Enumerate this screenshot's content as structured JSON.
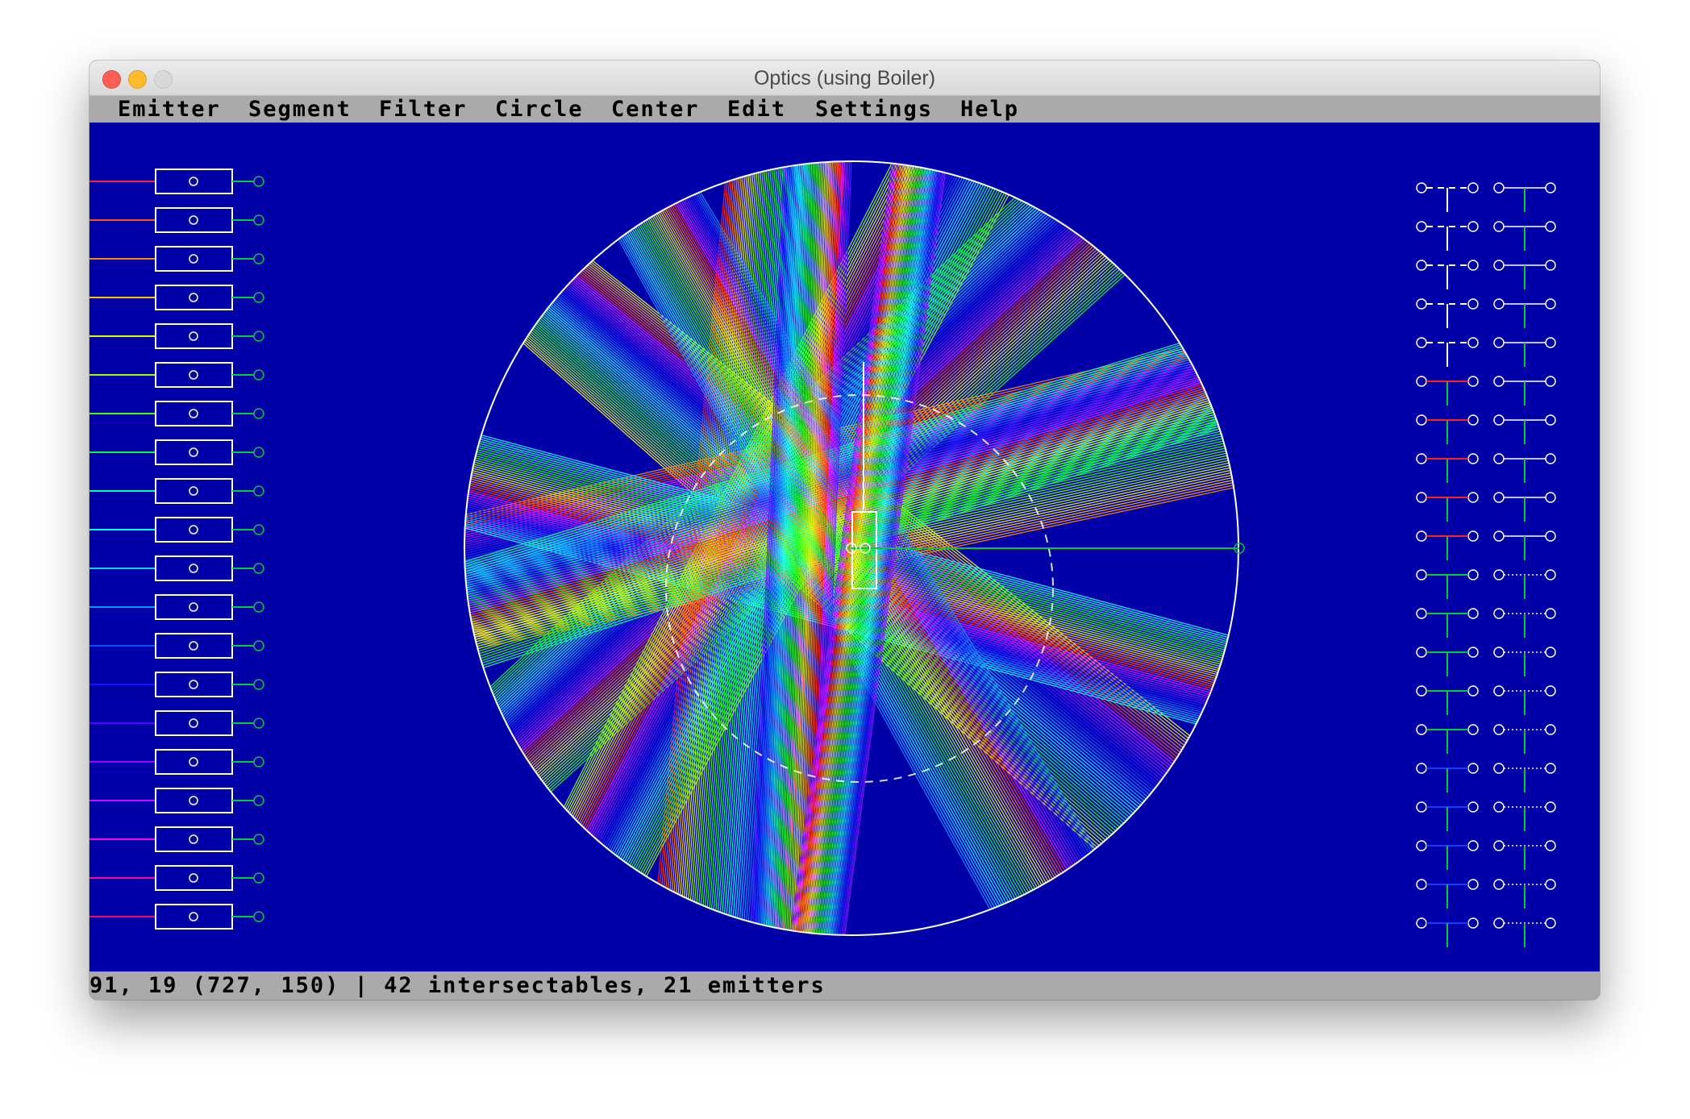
{
  "window": {
    "title": "Optics (using Boiler)"
  },
  "menu": [
    {
      "id": "emitter",
      "label": "Emitter"
    },
    {
      "id": "segment",
      "label": "Segment"
    },
    {
      "id": "filter",
      "label": "Filter"
    },
    {
      "id": "circle",
      "label": "Circle"
    },
    {
      "id": "center",
      "label": "Center"
    },
    {
      "id": "edit",
      "label": "Edit"
    },
    {
      "id": "settings",
      "label": "Settings"
    },
    {
      "id": "help",
      "label": "Help"
    }
  ],
  "status": {
    "text": "91, 19 (727, 150) | 42 intersectables, 21 emitters"
  },
  "scene": {
    "palette_count": 20,
    "emitter_colors": [
      "#ff1f3f",
      "#ff4d1a",
      "#ff8a00",
      "#ffc400",
      "#e0ff00",
      "#9cff00",
      "#41ff00",
      "#00ff3a",
      "#00ff9a",
      "#00ffe0",
      "#00d8ff",
      "#0098ff",
      "#0050ff",
      "#1414ff",
      "#5a00ff",
      "#9c00ff",
      "#d600ff",
      "#ff00e0",
      "#ff00a0",
      "#ff0060"
    ],
    "accent_green": "#00cc33",
    "line_white": "#ffffff",
    "background": "#0000a8",
    "component_rows": [
      {
        "left": "filter",
        "right": "segment"
      },
      {
        "left": "filter",
        "right": "segment"
      },
      {
        "left": "filter",
        "right": "segment"
      },
      {
        "left": "filter",
        "right": "segment"
      },
      {
        "left": "filter",
        "right": "segment"
      },
      {
        "left": "red-filter",
        "right": "segment"
      },
      {
        "left": "red-filter",
        "right": "segment"
      },
      {
        "left": "red-filter",
        "right": "segment"
      },
      {
        "left": "red-filter",
        "right": "segment"
      },
      {
        "left": "red-filter",
        "right": "segment"
      },
      {
        "left": "green-filter",
        "right": "dotted-segment"
      },
      {
        "left": "green-filter",
        "right": "dotted-segment"
      },
      {
        "left": "green-filter",
        "right": "dotted-segment"
      },
      {
        "left": "green-filter",
        "right": "dotted-segment"
      },
      {
        "left": "green-filter",
        "right": "dotted-segment"
      },
      {
        "left": "blue-filter",
        "right": "dotted-segment"
      },
      {
        "left": "blue-filter",
        "right": "dotted-segment"
      },
      {
        "left": "blue-filter",
        "right": "dotted-segment"
      },
      {
        "left": "blue-filter",
        "right": "dotted-segment"
      },
      {
        "left": "blue-filter",
        "right": "dotted-segment"
      }
    ]
  }
}
